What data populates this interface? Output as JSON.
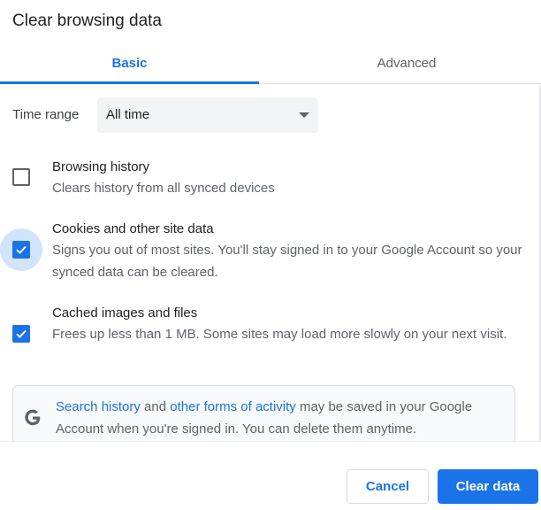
{
  "dialog": {
    "title": "Clear browsing data"
  },
  "tabs": [
    {
      "label": "Basic",
      "selected": true
    },
    {
      "label": "Advanced",
      "selected": false
    }
  ],
  "time_range": {
    "label": "Time range",
    "value": "All time"
  },
  "options": [
    {
      "title": "Browsing history",
      "description": "Clears history from all synced devices",
      "checked": false
    },
    {
      "title": "Cookies and other site data",
      "description": "Signs you out of most sites. You'll stay signed in to your Google Account so your synced data can be cleared.",
      "checked": true
    },
    {
      "title": "Cached images and files",
      "description": "Frees up less than 1 MB. Some sites may load more slowly on your next visit.",
      "checked": true
    }
  ],
  "info": {
    "icon": "google-g-icon",
    "link1": "Search history",
    "text1": " and ",
    "link2": "other forms of activity",
    "text2": " may be saved in your Google Account when you're signed in. You can delete them anytime."
  },
  "footer": {
    "cancel_label": "Cancel",
    "clear_label": "Clear data"
  },
  "colors": {
    "accent": "#1a73e8",
    "focus_halo": "#d2e3fc"
  }
}
